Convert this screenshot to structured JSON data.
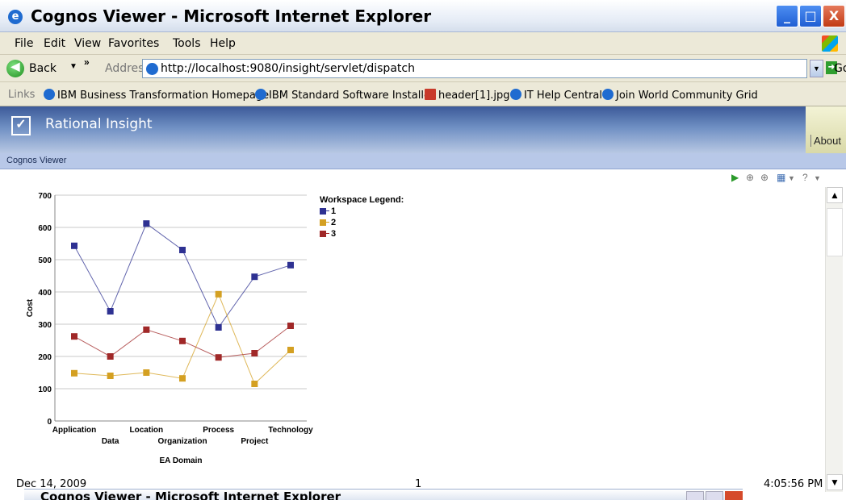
{
  "window": {
    "title": "Cognos Viewer - Microsoft Internet Explorer",
    "min": "_",
    "max": "□",
    "close": "X"
  },
  "menu": [
    "File",
    "Edit",
    "View",
    "Favorites",
    "Tools",
    "Help"
  ],
  "addressbar": {
    "back": "Back",
    "address_label": "Address",
    "url": "http://localhost:9080/insight/servlet/dispatch",
    "go": "Go"
  },
  "links": {
    "label": "Links",
    "items": [
      "IBM Business Transformation Homepage",
      "IBM Standard Software Installer",
      "header[1].jpg",
      "IT Help Central",
      "Join World Community Grid"
    ]
  },
  "app": {
    "brand": "Rational Insight",
    "about": "About",
    "viewer_label": "Cognos Viewer"
  },
  "footer": {
    "date": "Dec 14, 2009",
    "page": "1",
    "time": "4:05:56 PM"
  },
  "second_window": {
    "title": "Cognos Viewer - Microsoft Internet Explorer"
  },
  "colors": {
    "series1": "#2e3192",
    "series2": "#d4a022",
    "series3": "#a02828"
  },
  "chart_data": {
    "type": "line",
    "title": "",
    "xlabel": "EA Domain",
    "ylabel": "Cost",
    "ylim": [
      0,
      700
    ],
    "yticks": [
      0,
      100,
      200,
      300,
      400,
      500,
      600,
      700
    ],
    "grid": true,
    "legend_title": "Workspace Legend:",
    "legend_position": "right",
    "categories": [
      "Application",
      "Data",
      "Location",
      "Organization",
      "Process",
      "Project",
      "Technology"
    ],
    "series": [
      {
        "name": "1",
        "values": [
          543,
          340,
          612,
          530,
          290,
          447,
          483
        ]
      },
      {
        "name": "2",
        "values": [
          148,
          140,
          150,
          132,
          393,
          115,
          220
        ]
      },
      {
        "name": "3",
        "values": [
          262,
          200,
          283,
          248,
          197,
          210,
          295
        ]
      }
    ]
  }
}
